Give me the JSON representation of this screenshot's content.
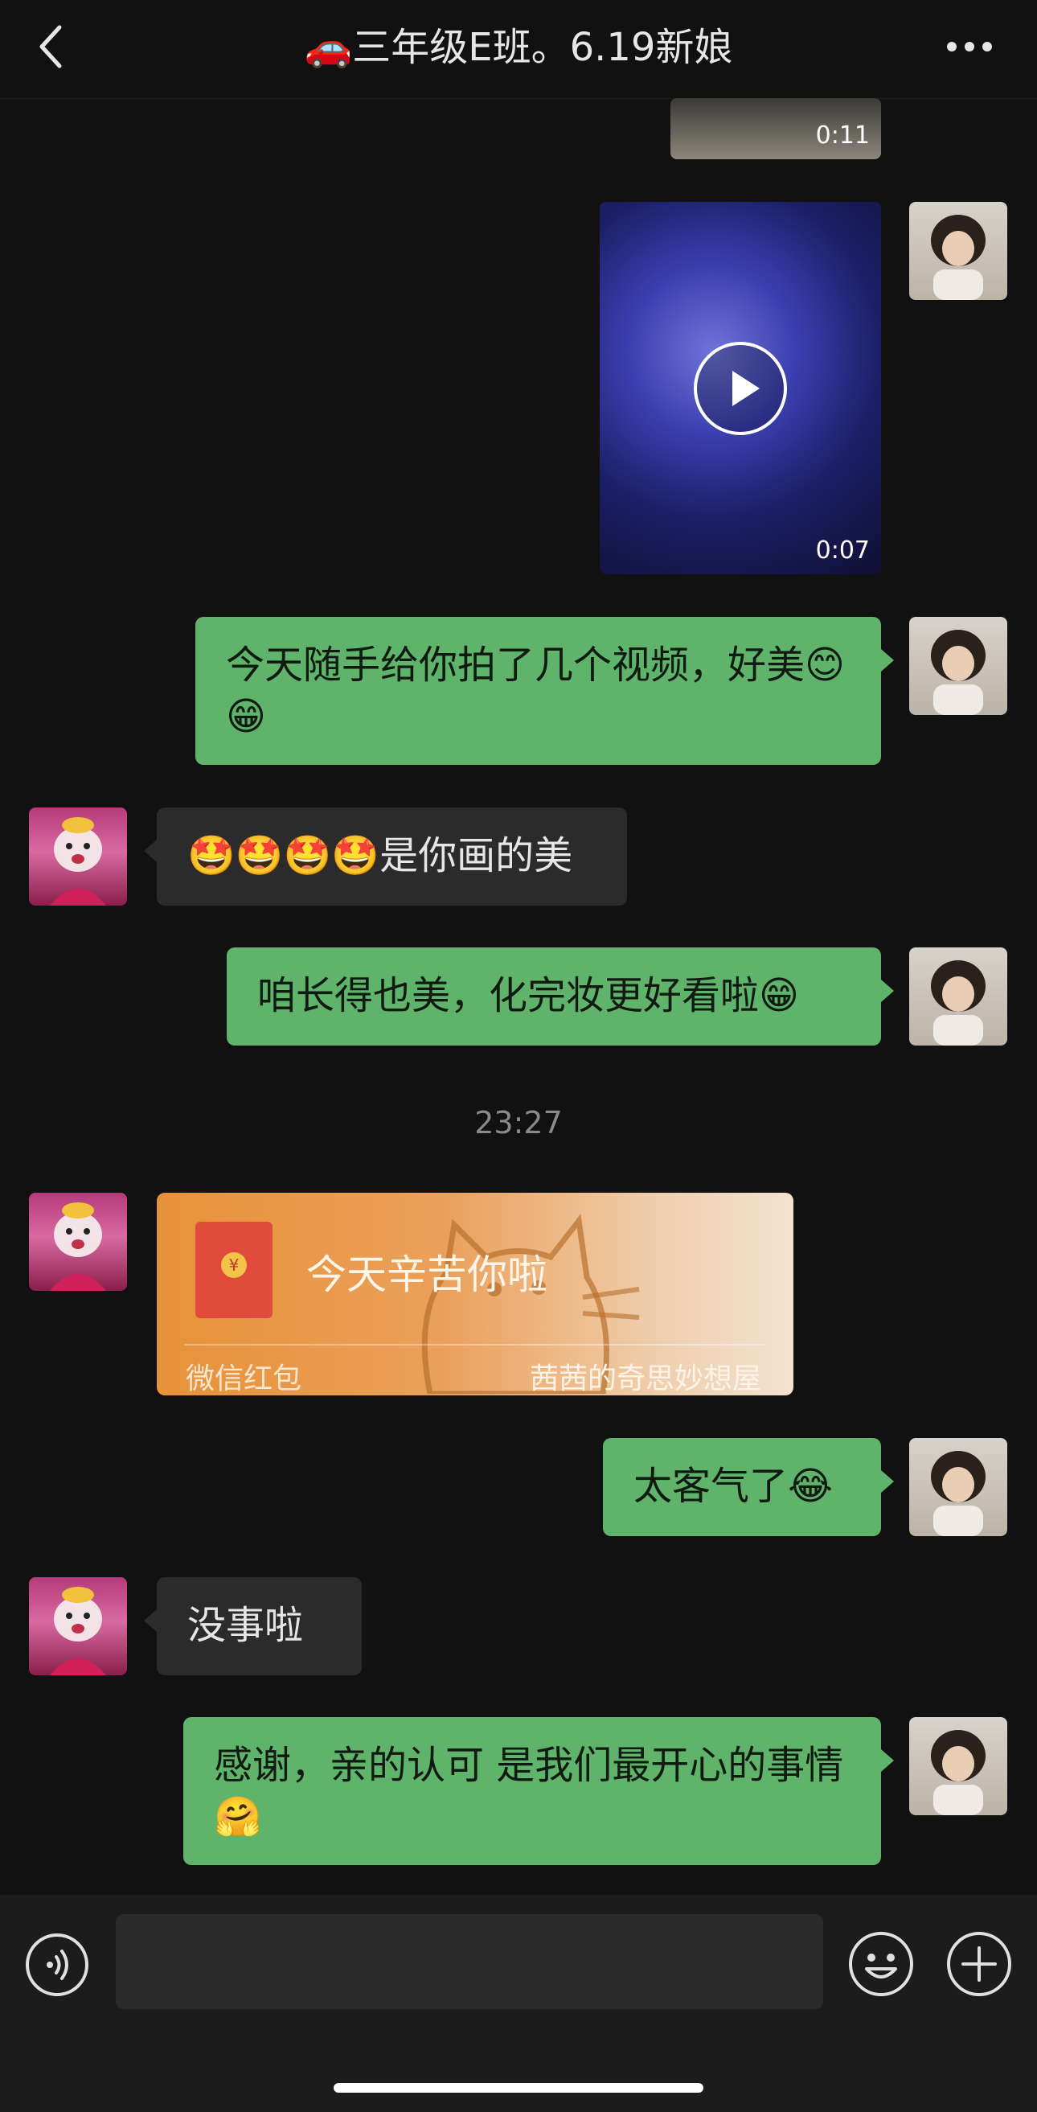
{
  "header": {
    "title": "🚗三年级E班。6.19新娘",
    "back_icon": "chevron-left-icon",
    "more_icon": "more-dots-icon"
  },
  "messages": [
    {
      "type": "video",
      "side": "me",
      "duration": "0:11"
    },
    {
      "type": "video",
      "side": "me",
      "duration": "0:07"
    },
    {
      "type": "text",
      "side": "me",
      "text": "今天随手给你拍了几个视频，好美😊😁"
    },
    {
      "type": "text",
      "side": "friend",
      "text": "🤩🤩🤩🤩是你画的美"
    },
    {
      "type": "text",
      "side": "me",
      "text": "咱长得也美，化完妆更好看啦😁"
    },
    {
      "type": "timestamp",
      "text": "23:27"
    },
    {
      "type": "red_packet",
      "side": "friend",
      "text": "今天辛苦你啦",
      "label": "微信红包",
      "brand": "茜茜的奇思妙想屋"
    },
    {
      "type": "text",
      "side": "me",
      "text": "太客气了😂"
    },
    {
      "type": "text",
      "side": "friend",
      "text": "没事啦"
    },
    {
      "type": "text",
      "side": "me",
      "text": "感谢，亲的认可 是我们最开心的事情🤗"
    }
  ],
  "input_bar": {
    "voice_icon": "voice-icon",
    "emoji_icon": "emoji-icon",
    "plus_icon": "plus-icon",
    "text_value": ""
  },
  "colors": {
    "background": "#111111",
    "my_bubble": "#5fb36a",
    "friend_bubble": "#2b2b2b",
    "red_packet": "#e8923a"
  }
}
